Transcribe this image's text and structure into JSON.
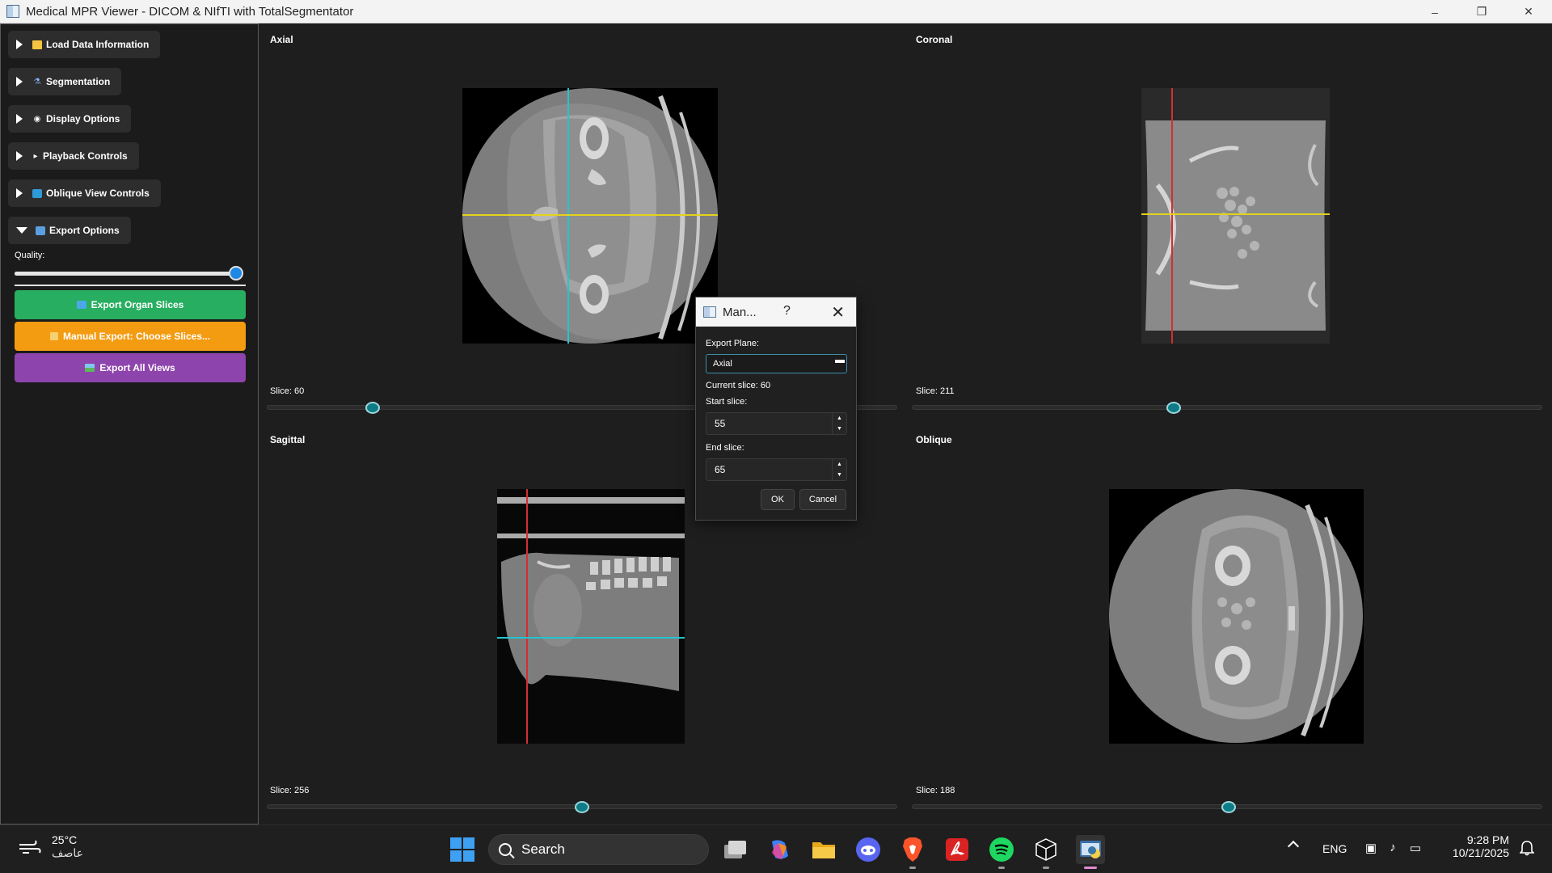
{
  "window": {
    "title": "Medical MPR Viewer - DICOM & NIfTI with TotalSegmentator",
    "controls": [
      "minimize",
      "restore",
      "close"
    ]
  },
  "sidebar": {
    "sections": [
      {
        "label": "Load Data  Information",
        "icon": "folder-icon",
        "expanded": false
      },
      {
        "label": "Segmentation",
        "icon": "microscope-icon",
        "expanded": false
      },
      {
        "label": "Display Options",
        "icon": "eye-icon",
        "expanded": false
      },
      {
        "label": "Playback Controls",
        "icon": "play-icon",
        "expanded": false
      },
      {
        "label": "Oblique View Controls",
        "icon": "rotate-icon",
        "expanded": false
      },
      {
        "label": "Export Options",
        "icon": "package-icon",
        "expanded": true
      }
    ],
    "quality_label": "Quality:",
    "quality_value": 1.0,
    "buttons": {
      "export_organ": "Export Organ Slices",
      "manual_export": "Manual Export: Choose Slices...",
      "export_all": "Export All Views"
    },
    "button_colors": {
      "export_organ": "#27ae60",
      "manual_export": "#f39c12",
      "export_all": "#8e44ad"
    }
  },
  "views": {
    "axial": {
      "title": "Axial",
      "slice_label": "Slice: 60",
      "slider_pos": 0.17
    },
    "coronal": {
      "title": "Coronal",
      "slice_label": "Slice: 211",
      "slider_pos": 0.41
    },
    "sagittal": {
      "title": "Sagittal",
      "slice_label": "Slice: 256",
      "slider_pos": 0.5
    },
    "oblique": {
      "title": "Oblique",
      "slice_label": "Slice: 188",
      "slider_pos": 0.5
    }
  },
  "dialog": {
    "title": "Man...",
    "help": "?",
    "export_plane_label": "Export Plane:",
    "export_plane_value": "Axial",
    "current_slice": "Current slice: 60",
    "start_label": "Start slice:",
    "start_value": "55",
    "end_label": "End slice:",
    "end_value": "65",
    "ok": "OK",
    "cancel": "Cancel"
  },
  "taskbar": {
    "weather_temp": "25°C",
    "weather_desc": "عاصف",
    "search_text": "Search",
    "language": "ENG",
    "time": "9:28 PM",
    "date": "10/21/2025"
  }
}
